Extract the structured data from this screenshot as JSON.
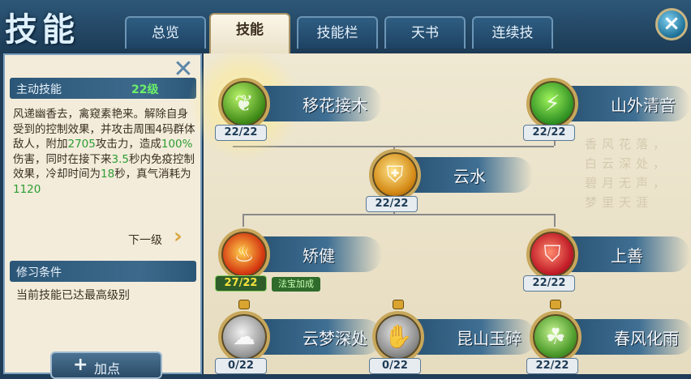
{
  "header": {
    "title": "技能",
    "tabs": [
      {
        "label": "总览",
        "active": false
      },
      {
        "label": "技能",
        "active": true
      },
      {
        "label": "技能栏",
        "active": false
      },
      {
        "label": "天书",
        "active": false
      },
      {
        "label": "连续技",
        "active": false
      }
    ],
    "close_icon": "close-icon"
  },
  "left_panel": {
    "section_title": "主动技能",
    "level": "22级",
    "description_parts": [
      {
        "text": "风递幽香去，禽窥素艳来。解除自身受到的控制效果，并攻击周围4码群体敌人，附加",
        "hl": false
      },
      {
        "text": "2705",
        "hl": true
      },
      {
        "text": "攻击力，造成",
        "hl": false
      },
      {
        "text": "100%",
        "hl": true
      },
      {
        "text": "伤害，同时在接下来",
        "hl": false
      },
      {
        "text": "3.5",
        "hl": true
      },
      {
        "text": "秒内免疫控制效果，冷却时间为",
        "hl": false
      },
      {
        "text": "18",
        "hl": true
      },
      {
        "text": "秒，真气消耗为",
        "hl": false
      },
      {
        "text": "1120",
        "hl": true
      }
    ],
    "next_level_label": "下一级",
    "condition_title": "修习条件",
    "condition_text": "当前技能已达最高级别",
    "add_point_label": "加点",
    "highlight_color": "#2c9c32"
  },
  "skills": [
    {
      "name": "移花接木",
      "count": "22/22",
      "icon": "flower-leaf-icon",
      "selected": true
    },
    {
      "name": "山外清音",
      "count": "22/22",
      "icon": "green-blades-icon"
    },
    {
      "name": "云水",
      "count": "22/22",
      "icon": "gold-shield-icon"
    },
    {
      "name": "矫健",
      "count": "27/22",
      "icon": "flame-figure-icon",
      "badge": "法宝加成"
    },
    {
      "name": "上善",
      "count": "22/22",
      "icon": "red-shield-icon"
    },
    {
      "name": "云梦深处",
      "count": "0/22",
      "icon": "grey-swirl-icon",
      "locked": true
    },
    {
      "name": "昆山玉碎",
      "count": "0/22",
      "icon": "grey-hand-icon",
      "locked": true
    },
    {
      "name": "春风化雨",
      "count": "22/22",
      "icon": "green-figure-icon",
      "locked": true
    }
  ],
  "background_text": "香风花落，白云深处，碧月无声，梦里天涯"
}
